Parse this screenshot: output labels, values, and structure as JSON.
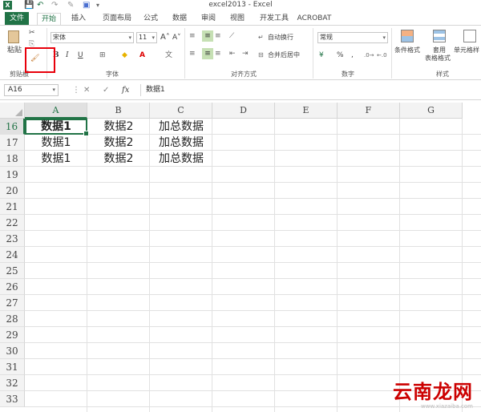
{
  "window": {
    "title": "excel2013 - Excel",
    "app_icon": "X"
  },
  "ribbon_tabs": [
    "文件",
    "开始",
    "插入",
    "页面布局",
    "公式",
    "数据",
    "审阅",
    "视图",
    "开发工具",
    "ACROBAT"
  ],
  "ribbon": {
    "clipboard": {
      "paste_label": "粘贴",
      "group_label": "剪贴板"
    },
    "font": {
      "font_name": "宋体",
      "font_size": "11",
      "group_label": "字体",
      "bold": "B",
      "italic": "I",
      "underline": "U"
    },
    "alignment": {
      "wrap_text": "自动换行",
      "merge_center": "合并后居中",
      "group_label": "对齐方式"
    },
    "number": {
      "format": "常规",
      "percent": "%",
      "comma": ",",
      "group_label": "数字"
    },
    "styles": {
      "conditional": "条件格式",
      "table_format_1": "套用",
      "table_format_2": "表格格式",
      "cell_styles": "单元格样",
      "group_label": "样式"
    }
  },
  "formula_bar": {
    "name_box": "A16",
    "fx": "fx",
    "value": "数据1"
  },
  "grid": {
    "columns": [
      "A",
      "B",
      "C",
      "D",
      "E",
      "F",
      "G"
    ],
    "rows": [
      "16",
      "17",
      "18",
      "19",
      "20",
      "21",
      "22",
      "23",
      "24",
      "25",
      "26",
      "27",
      "28",
      "29",
      "30",
      "31",
      "32",
      "33"
    ],
    "cells": [
      [
        "数据1",
        "数据2",
        "加总数据"
      ],
      [
        "数据1",
        "数据2",
        "加总数据"
      ],
      [
        "数据1",
        "数据2",
        "加总数据"
      ]
    ]
  },
  "watermark": {
    "text": "云南龙网",
    "sub": "www.xiazaiba.com"
  },
  "colors": {
    "accent": "#217346",
    "highlight": "#e8000b"
  }
}
